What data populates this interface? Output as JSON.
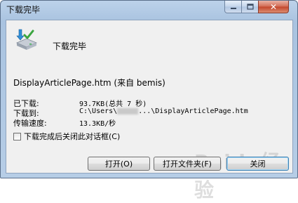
{
  "window": {
    "title": "下载完毕",
    "controls": {
      "minimize_icon": "minimize-icon",
      "maximize_icon": "maximize-icon",
      "close_label": "✕"
    }
  },
  "dialog": {
    "heading": "下载完毕",
    "filename": "DisplayArticlePage.htm (来自 bemis)",
    "downloaded_label": "已下载:",
    "downloaded_value": "93.7KB(总共 7 秒)",
    "download_to_label": "下载到:",
    "download_to_prefix": "C:\\Users\\",
    "download_to_suffix": "...\\DisplayArticlePage.htm",
    "speed_label": "传输速度:",
    "speed_value": "13.3KB/秒",
    "close_after_label": "下载完成后关闭此对话框(C)",
    "close_after_checked": false
  },
  "buttons": {
    "open": "打开(O)",
    "open_folder": "打开文件夹(F)",
    "close": "关闭"
  },
  "watermark": "Baidu经验",
  "icons": {
    "download_complete": "download-complete-icon"
  }
}
